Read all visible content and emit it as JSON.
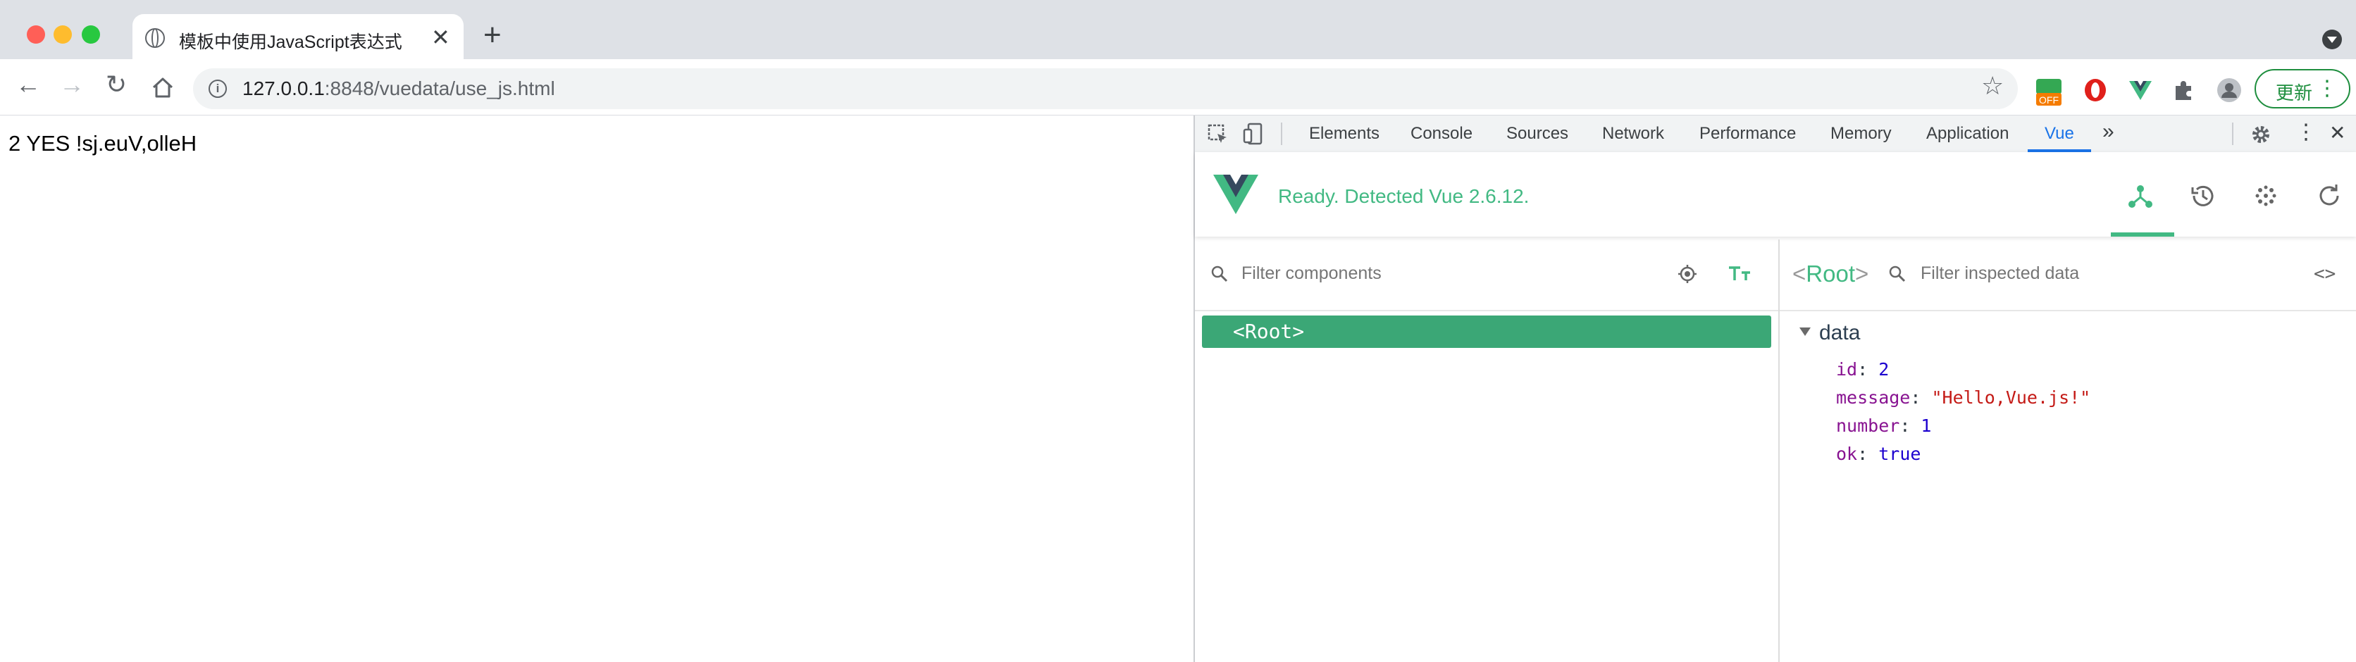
{
  "browser": {
    "tab_title": "模板中使用JavaScript表达式",
    "url_host": "127.0.0.1",
    "url_rest": ":8848/vuedata/use_js.html",
    "update_label": "更新",
    "ext_off_badge": "OFF"
  },
  "page": {
    "content": "2 YES !sj.euV,olleH"
  },
  "devtools": {
    "tabs": [
      "Elements",
      "Console",
      "Sources",
      "Network",
      "Performance",
      "Memory",
      "Application",
      "Vue"
    ],
    "active_tab": "Vue",
    "vue": {
      "status": "Ready. Detected Vue 2.6.12.",
      "filter_components_placeholder": "Filter components",
      "filter_data_placeholder": "Filter inspected data",
      "root_component": "<Root>",
      "inspected_name": "Root",
      "data_heading": "data",
      "data": [
        {
          "key": "id",
          "value": "2",
          "kind": "num"
        },
        {
          "key": "message",
          "value": "\"Hello,Vue.js!\"",
          "kind": "str"
        },
        {
          "key": "number",
          "value": "1",
          "kind": "num"
        },
        {
          "key": "ok",
          "value": "true",
          "kind": "bool"
        }
      ]
    }
  },
  "colors": {
    "vue_green": "#42b983",
    "selected_row": "#3ba776",
    "devtools_active": "#1a73e8"
  }
}
